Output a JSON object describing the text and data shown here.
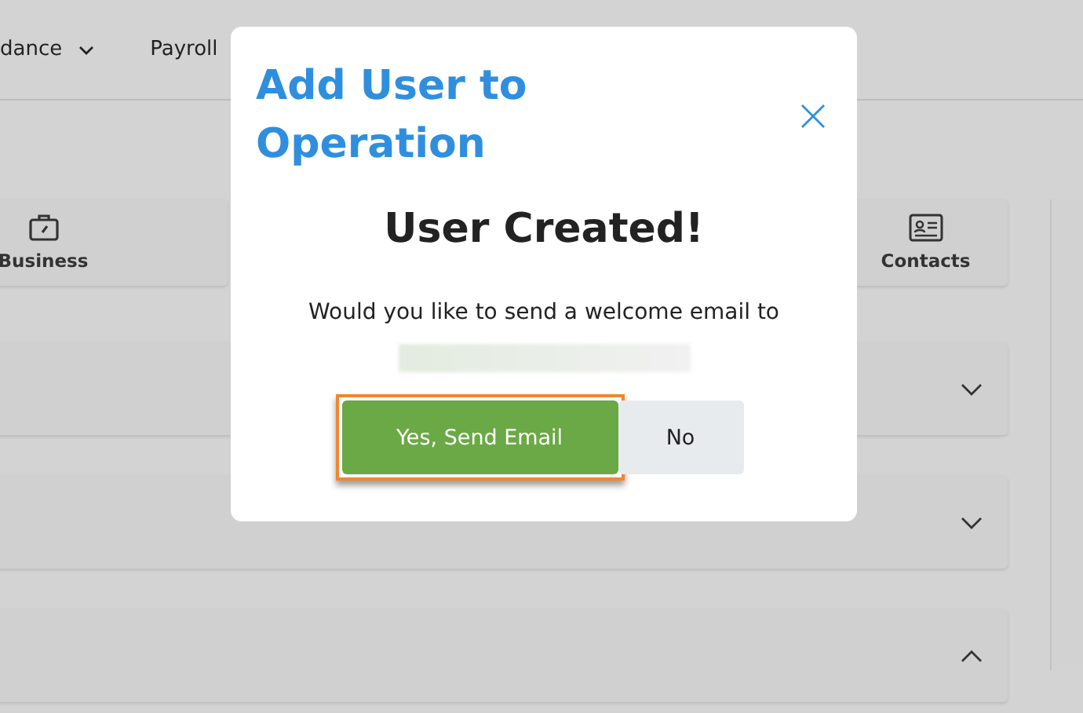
{
  "nav": {
    "items": [
      {
        "label": "dance",
        "dropdown": true
      },
      {
        "label": "Payroll",
        "dropdown": false
      }
    ]
  },
  "tiles": [
    {
      "label": "Business",
      "kind": "briefcase"
    },
    {
      "label": "Contacts",
      "kind": "card"
    }
  ],
  "accordions": [
    {
      "expanded": false
    },
    {
      "expanded": false
    },
    {
      "expanded": true
    }
  ],
  "modal": {
    "title": "Add User to Operation",
    "heading": "User Created!",
    "message": "Would you like to send a welcome email to",
    "buttons": [
      {
        "label": "Yes, Send Email",
        "kind": "primary",
        "highlighted": true
      },
      {
        "label": "No",
        "kind": "secondary",
        "highlighted": false
      }
    ]
  }
}
